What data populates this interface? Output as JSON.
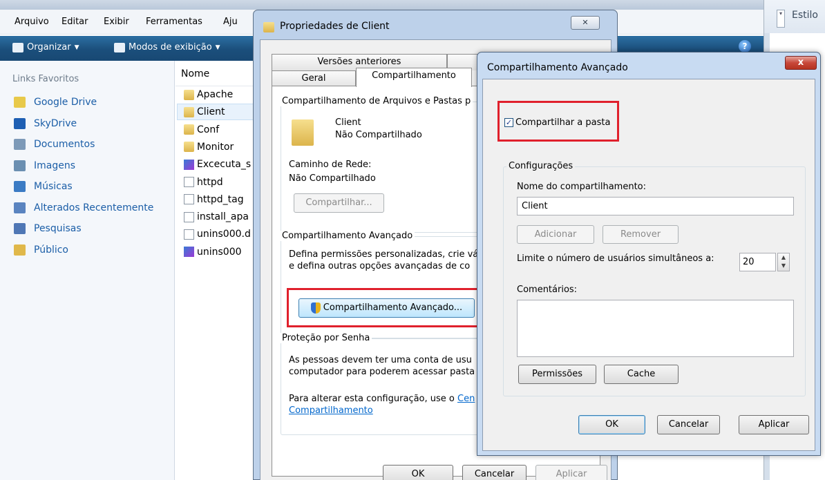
{
  "explorer": {
    "menu": [
      "Arquivo",
      "Editar",
      "Exibir",
      "Ferramentas",
      "Aju"
    ],
    "toolbar": {
      "organize": "Organizar",
      "views": "Modos de exibição"
    },
    "sidebar": {
      "title": "Links Favoritos",
      "items": [
        {
          "label": "Google Drive",
          "icon": "google-drive-icon",
          "color": "#e8c94a"
        },
        {
          "label": "SkyDrive",
          "icon": "skydrive-icon",
          "color": "#1e5fb3"
        },
        {
          "label": "Documentos",
          "icon": "documents-icon",
          "color": "#7d9ab8"
        },
        {
          "label": "Imagens",
          "icon": "pictures-icon",
          "color": "#6b8fb1"
        },
        {
          "label": "Músicas",
          "icon": "music-icon",
          "color": "#3b7bc4"
        },
        {
          "label": "Alterados Recentemente",
          "icon": "recent-icon",
          "color": "#5a84c0"
        },
        {
          "label": "Pesquisas",
          "icon": "search-folder-icon",
          "color": "#4f77b5"
        },
        {
          "label": "Público",
          "icon": "public-folder-icon",
          "color": "#e0b84a"
        }
      ]
    },
    "filelist": {
      "column_name": "Nome",
      "files": [
        {
          "name": "Apache",
          "type": "folder"
        },
        {
          "name": "Client",
          "type": "folder"
        },
        {
          "name": "Conf",
          "type": "folder"
        },
        {
          "name": "Monitor",
          "type": "folder"
        },
        {
          "name": "Excecuta_s",
          "type": "app"
        },
        {
          "name": "httpd",
          "type": "doc"
        },
        {
          "name": "httpd_tag",
          "type": "doc"
        },
        {
          "name": "install_apa",
          "type": "doc"
        },
        {
          "name": "unins000.d",
          "type": "doc"
        },
        {
          "name": "unins000",
          "type": "app"
        }
      ]
    },
    "right_pane": {
      "label": "Estilo"
    }
  },
  "properties": {
    "title": "Propriedades de Client",
    "close": "✕",
    "tabs_row1": [
      "Versões anteriores",
      ""
    ],
    "tabs_row2": [
      "Geral",
      "Compartilhamento"
    ],
    "file_sharing": {
      "group": "Compartilhamento de Arquivos e Pastas p",
      "name": "Client",
      "status": "Não Compartilhado",
      "path_label": "Caminho de Rede:",
      "path_value": "Não Compartilhado",
      "share_button": "Compartilhar..."
    },
    "advanced": {
      "group": "Compartilhamento Avançado",
      "desc1": "Defina permissões personalizadas, crie vá",
      "desc2": "e defina outras opções avançadas de co",
      "button": "Compartilhamento Avançado..."
    },
    "password": {
      "group": "Proteção por Senha",
      "desc1": "As pessoas devem ter uma conta de usu",
      "desc2": "computador para poderem acessar pasta",
      "desc3": "Para alterar esta configuração, use o ",
      "link1": "Cen",
      "link2": "Compartilhamento"
    },
    "buttons": {
      "ok": "OK",
      "cancel": "Cancelar",
      "apply": "Aplicar"
    }
  },
  "advanced_dialog": {
    "title": "Compartilhamento Avançado",
    "close": "x",
    "share_checkbox": {
      "label": "Compartilhar a pasta",
      "checked": true,
      "mark": "✓"
    },
    "settings_group": "Configurações",
    "share_name_label": "Nome do compartilhamento:",
    "share_name_value": "Client",
    "add_button": "Adicionar",
    "remove_button": "Remover",
    "limit_label": "Limite o número de usuários simultâneos a:",
    "limit_value": "20",
    "comments_label": "Comentários:",
    "comments_value": "",
    "permissions_button": "Permissões",
    "cache_button": "Cache",
    "ok": "OK",
    "cancel": "Cancelar",
    "apply": "Aplicar"
  }
}
